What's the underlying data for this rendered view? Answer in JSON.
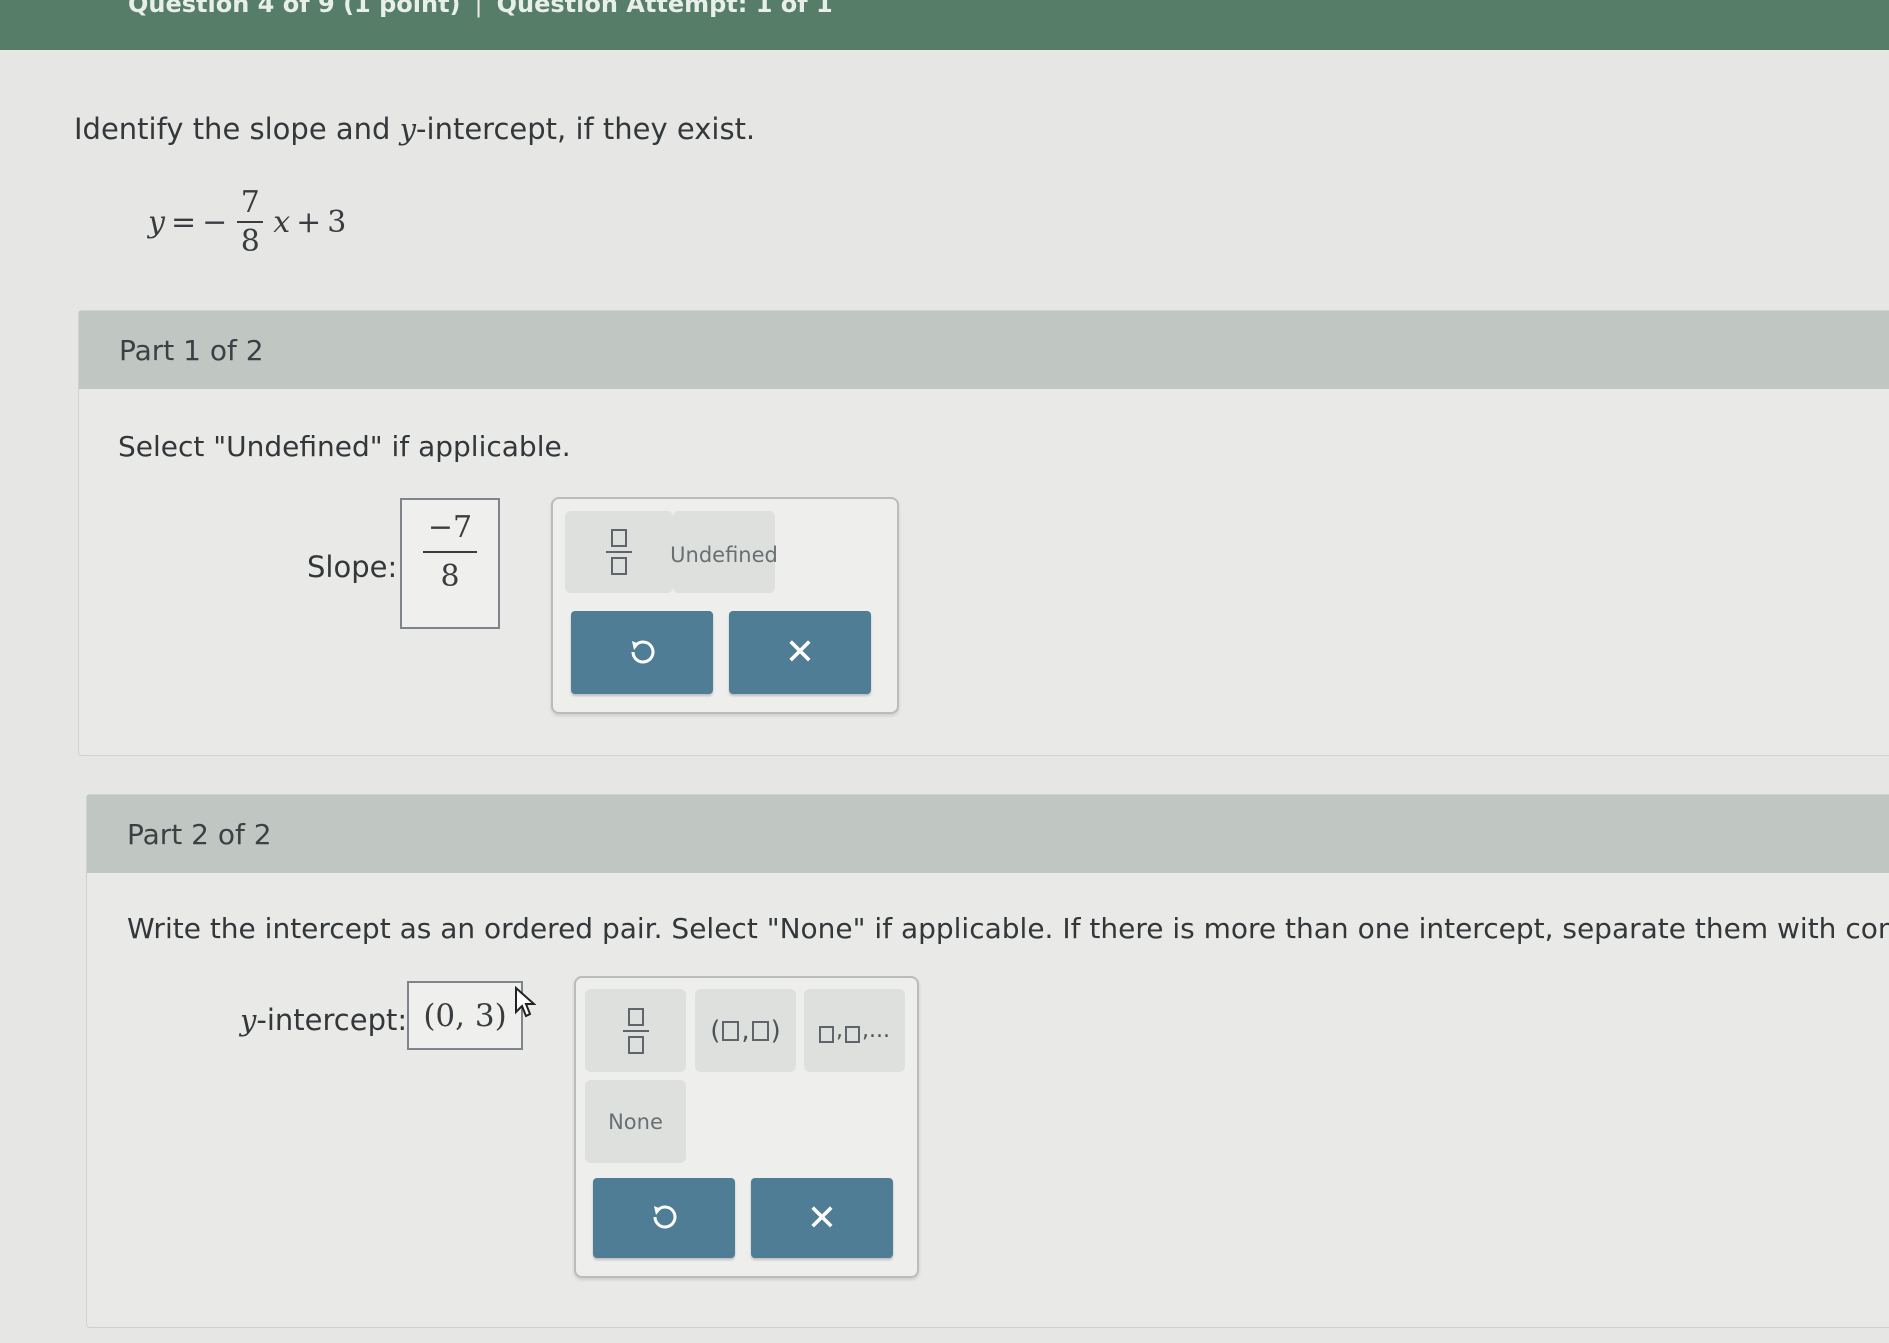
{
  "header": {
    "question_label": "Question 4 of 9 (1 point)",
    "separator": "|",
    "attempt_label": "Question Attempt: 1 of 1"
  },
  "question": {
    "prompt_before": "Identify the slope and ",
    "prompt_var": "y",
    "prompt_after": "-intercept, if they exist.",
    "equation": {
      "lhs": "y",
      "equals": "=",
      "minus": "−",
      "numerator": "7",
      "denominator": "8",
      "variable": "x",
      "plus": "+",
      "constant": "3"
    }
  },
  "part1": {
    "header": "Part 1 of 2",
    "instruction": "Select \"Undefined\" if applicable.",
    "answer_label": "Slope:",
    "answer_numerator": "−7",
    "answer_denominator": "8",
    "palette": {
      "fraction_icon": "fraction-template-icon",
      "undefined_label": "Undefined",
      "undo_icon": "undo-icon",
      "clear_icon": "close-icon",
      "clear_symbol": "✕"
    }
  },
  "part2": {
    "header": "Part 2 of 2",
    "instruction": "Write the intercept as an ordered pair. Select \"None\" if applicable. If there is more than one intercept, separate them with commas.",
    "answer_label_var": "y",
    "answer_label_rest": "-intercept:",
    "answer_value": "(0, 3)",
    "palette": {
      "fraction_icon": "fraction-template-icon",
      "pair_open": "(",
      "pair_comma": ",",
      "pair_close": ")",
      "list_comma": ",",
      "list_ellipsis": ",...",
      "none_label": "None",
      "undo_icon": "undo-icon",
      "clear_icon": "close-icon",
      "clear_symbol": "✕"
    }
  },
  "colors": {
    "topbar": "#557d67",
    "part_header": "#c0c7c3",
    "action_button": "#4f7d96",
    "background": "#e6e7e4"
  }
}
